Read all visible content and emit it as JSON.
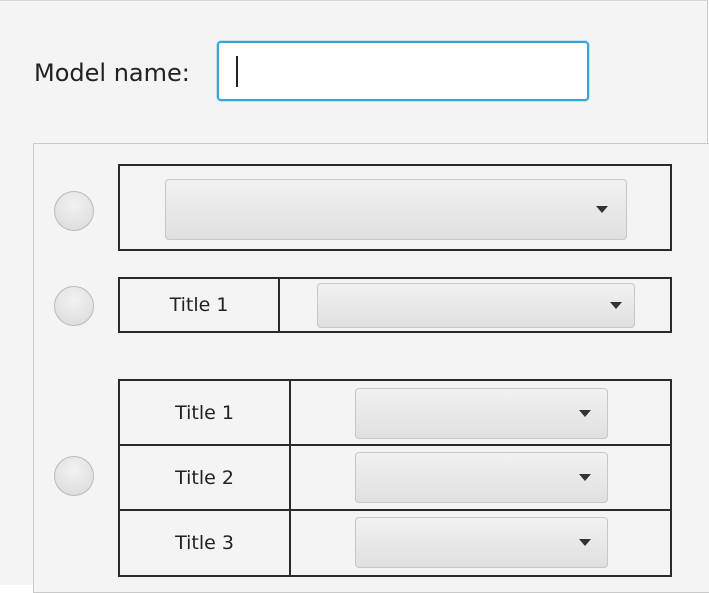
{
  "form": {
    "model_name_label": "Model name:",
    "model_name_value": "",
    "model_name_placeholder": ""
  },
  "options": [
    {
      "type": "single-combo",
      "selected": false,
      "combo_value": ""
    },
    {
      "type": "titled-combo",
      "selected": false,
      "title": "Title 1",
      "combo_value": ""
    },
    {
      "type": "table-combos",
      "selected": false,
      "rows": [
        {
          "title": "Title 1",
          "combo_value": ""
        },
        {
          "title": "Title 2",
          "combo_value": ""
        },
        {
          "title": "Title 3",
          "combo_value": ""
        }
      ]
    }
  ],
  "icons": {
    "dropdown": "chevron-down-icon"
  }
}
